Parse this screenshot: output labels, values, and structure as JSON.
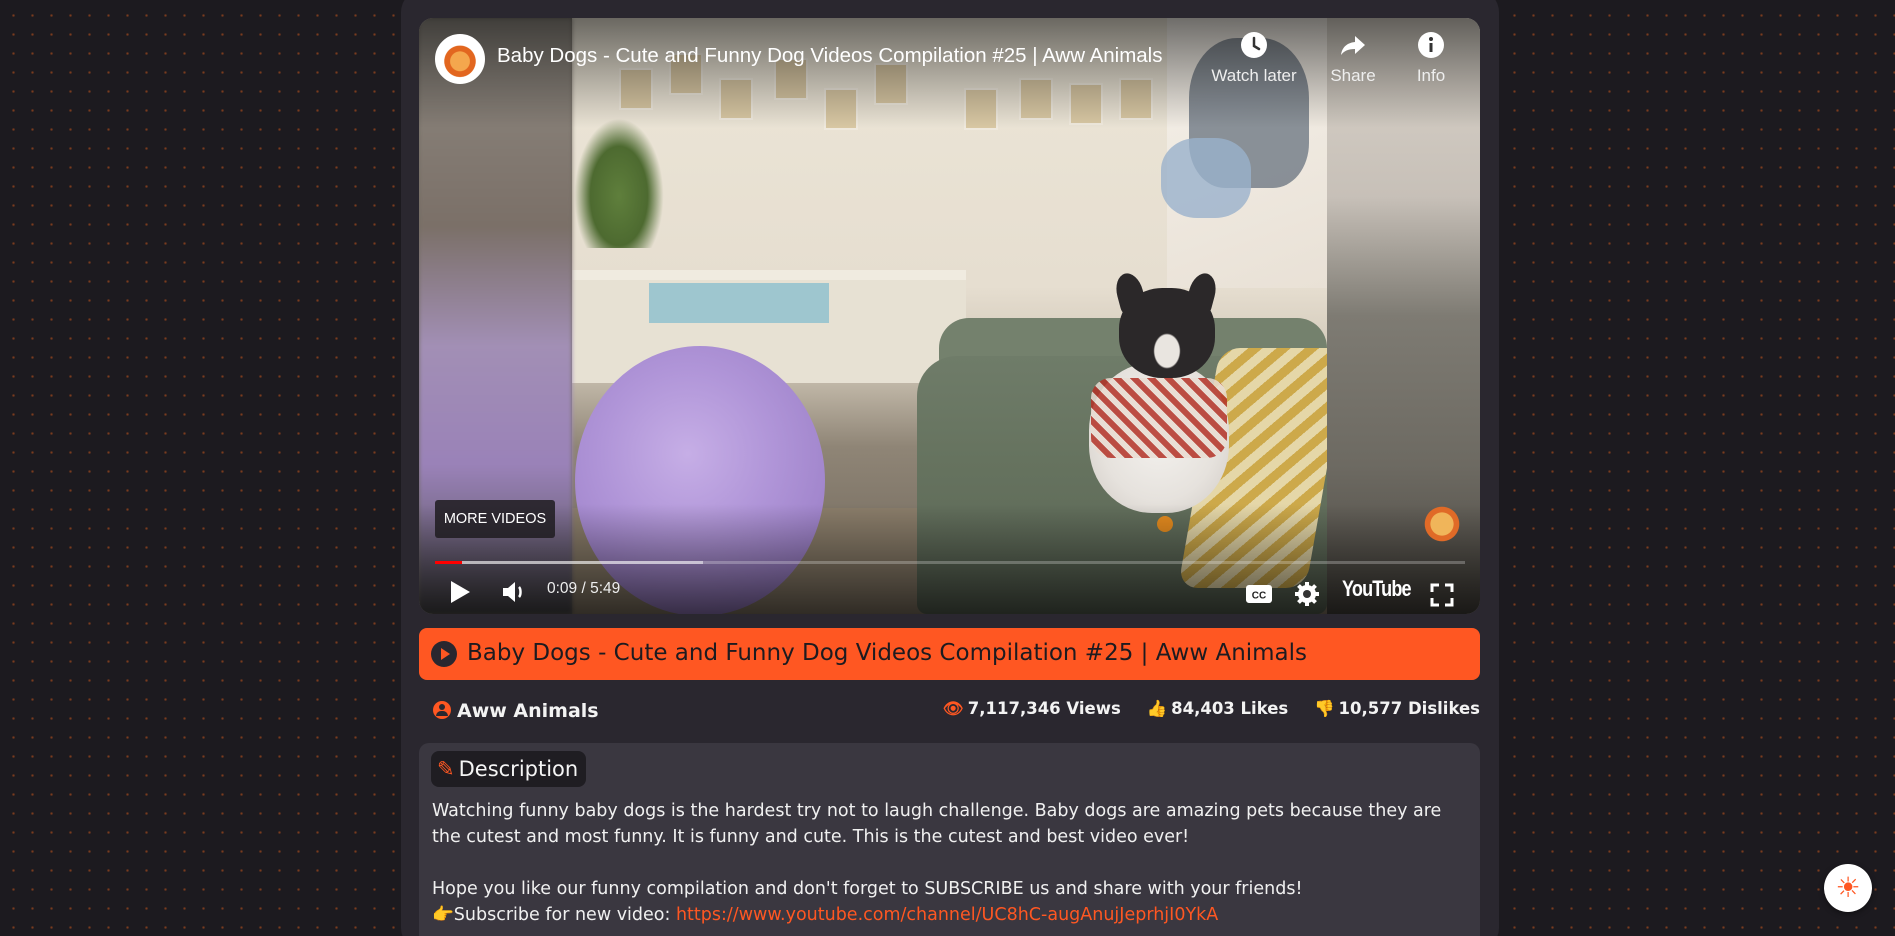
{
  "player": {
    "video_title": "Baby Dogs - Cute and Funny Dog Videos Compilation #25 | Aww Animals",
    "actions": [
      {
        "label": "Watch later",
        "icon": "clock-icon"
      },
      {
        "label": "Share",
        "icon": "share-icon"
      },
      {
        "label": "Info",
        "icon": "info-icon"
      }
    ],
    "more_videos_label": "MORE VIDEOS",
    "time_display": "0:09 / 5:49",
    "progress_played_fraction": 0.026,
    "progress_loaded_fraction": 0.26,
    "brand_label": "YouTube"
  },
  "video": {
    "title": "Baby Dogs - Cute and Funny Dog Videos Compilation #25 | Aww Animals",
    "channel": "Aww Animals",
    "views": "7,117,346 Views",
    "likes": "84,403 Likes",
    "dislikes": "10,577 Dislikes"
  },
  "description": {
    "heading": "Description",
    "para1": "Watching funny baby dogs is the hardest try not to laugh challenge. Baby dogs are amazing pets because they are the cutest and most funny. It is funny and cute. This is the cutest and best video ever!",
    "para2": "Hope you like our funny compilation and don't forget to SUBSCRIBE us and share with your friends!",
    "subscribe_prefix": "Subscribe for new video: ",
    "subscribe_link": "https://www.youtube.com/channel/UC8hC-augAnujJeprhjI0YkA",
    "pointer_emoji": "👉"
  },
  "colors": {
    "accent": "#ff5722",
    "background": "#1c1a1f",
    "card": "#2a272f",
    "progress_played": "#ff0000"
  }
}
